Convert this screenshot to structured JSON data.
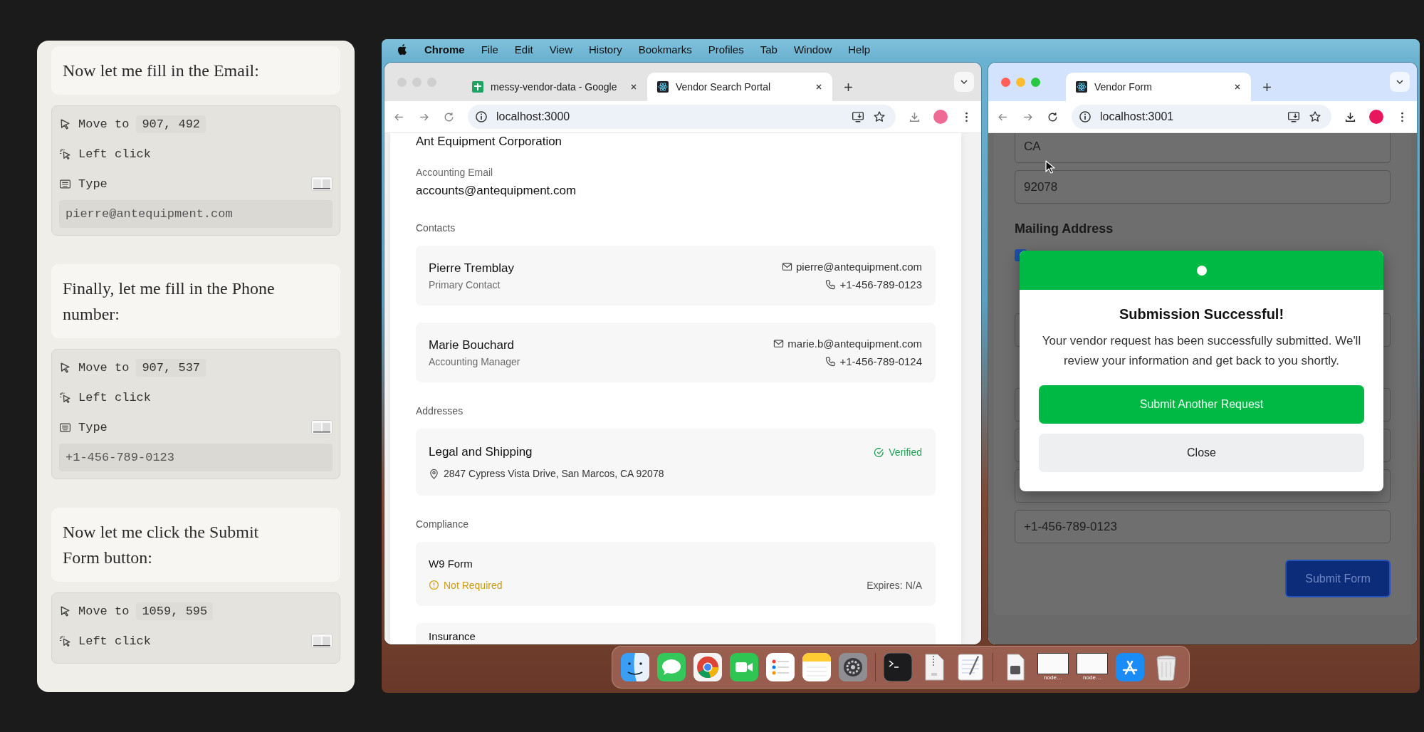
{
  "assistant_panel": {
    "steps": [
      {
        "kind": "message",
        "text": "Now let me fill in the Email:"
      },
      {
        "kind": "actions",
        "actions": [
          {
            "kind": "move",
            "label": "Move to",
            "value": "907, 492"
          },
          {
            "kind": "click",
            "label": "Left click"
          },
          {
            "kind": "type",
            "label": "Type",
            "screenshot": true,
            "typed": "pierre@antequipment.com"
          }
        ]
      },
      {
        "kind": "message",
        "text": "Finally, let me fill in the Phone number:"
      },
      {
        "kind": "actions",
        "actions": [
          {
            "kind": "move",
            "label": "Move to",
            "value": "907, 537"
          },
          {
            "kind": "click",
            "label": "Left click"
          },
          {
            "kind": "type",
            "label": "Type",
            "screenshot": true,
            "typed": "+1-456-789-0123"
          }
        ]
      },
      {
        "kind": "message",
        "text": "Now let me click the Submit Form button:"
      },
      {
        "kind": "actions",
        "actions": [
          {
            "kind": "move",
            "label": "Move to",
            "value": "1059, 595"
          },
          {
            "kind": "click",
            "label": "Left click",
            "screenshot": true
          }
        ]
      }
    ]
  },
  "menu_bar": {
    "app": "Chrome",
    "items": [
      "File",
      "Edit",
      "View",
      "History",
      "Bookmarks",
      "Profiles",
      "Tab",
      "Window",
      "Help"
    ]
  },
  "portal_window": {
    "focused": false,
    "tabs": [
      {
        "title": "messy-vendor-data - Google",
        "kind": "sheets",
        "selected": false
      },
      {
        "title": "Vendor Search Portal",
        "kind": "react",
        "selected": true
      }
    ],
    "url": "localhost:3000",
    "company_name": "Ant Equipment Corporation",
    "accounting_email": {
      "label": "Accounting Email",
      "value": "accounts@antequipment.com"
    },
    "sections": [
      {
        "title": "Contacts",
        "kind": "contacts",
        "items": [
          {
            "name": "Pierre Tremblay",
            "role": "Primary Contact",
            "email": "pierre@antequipment.com",
            "phone": "+1-456-789-0123"
          },
          {
            "name": "Marie Bouchard",
            "role": "Accounting Manager",
            "email": "marie.b@antequipment.com",
            "phone": "+1-456-789-0124"
          }
        ]
      },
      {
        "title": "Addresses",
        "kind": "addresses",
        "items": [
          {
            "name": "Legal and Shipping",
            "address": "2847 Cypress Vista Drive, San Marcos, CA 92078",
            "status": {
              "text": "Verified",
              "kind": "ok"
            }
          }
        ]
      },
      {
        "title": "Compliance",
        "kind": "compliance",
        "items": [
          {
            "name": "W9 Form",
            "status": {
              "text": "Not Required",
              "kind": "warning"
            },
            "expires": "Expires: N/A"
          },
          {
            "name": "Insurance"
          }
        ]
      }
    ]
  },
  "form_window": {
    "focused": true,
    "tabs": [
      {
        "title": "Vendor Form",
        "kind": "react",
        "selected": true
      }
    ],
    "url": "localhost:3001",
    "fields": [
      "CA",
      "92078"
    ],
    "mailing_heading": "Mailing Address",
    "mailing_checkbox": {
      "checked": true
    },
    "phone_value": "+1-456-789-0123",
    "submit_button": "Submit Form",
    "dialog": {
      "title": "Submission Successful!",
      "message": "Your vendor request has been successfully submitted. We'll review your information and get back to you shortly.",
      "buttons": [
        {
          "label": "Submit Another Request",
          "kind": "primary"
        },
        {
          "label": "Close",
          "kind": "secondary"
        }
      ]
    }
  },
  "dock": {
    "items": [
      {
        "kind": "finder"
      },
      {
        "kind": "messages"
      },
      {
        "kind": "chrome"
      },
      {
        "kind": "facetime"
      },
      {
        "kind": "reminders"
      },
      {
        "kind": "notes"
      },
      {
        "kind": "settings"
      },
      {
        "kind": "divider"
      },
      {
        "kind": "terminal"
      },
      {
        "kind": "archive"
      },
      {
        "kind": "textedit"
      },
      {
        "kind": "divider"
      },
      {
        "kind": "document"
      },
      {
        "kind": "window",
        "label": "node…"
      },
      {
        "kind": "window",
        "label": "node…"
      },
      {
        "kind": "appstore"
      },
      {
        "kind": "trash"
      }
    ]
  }
}
